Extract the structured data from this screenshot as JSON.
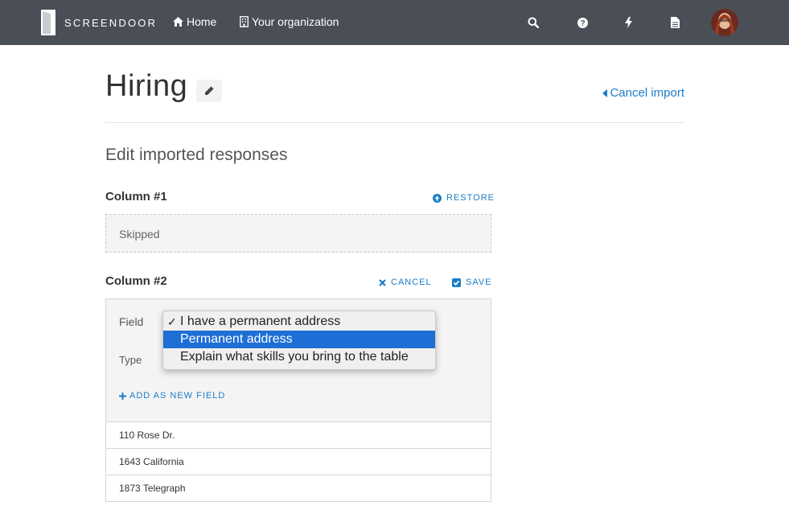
{
  "nav": {
    "brand": "SCREENDOOR",
    "home_label": "Home",
    "org_label": "Your organization",
    "icons": [
      "search-icon",
      "help-icon",
      "bolt-icon",
      "document-icon"
    ]
  },
  "header": {
    "title": "Hiring",
    "cancel_import": "Cancel import"
  },
  "section": {
    "title": "Edit imported responses"
  },
  "column1": {
    "heading": "Column #1",
    "restore": "RESTORE",
    "skipped": "Skipped"
  },
  "column2": {
    "heading": "Column #2",
    "cancel": "CANCEL",
    "save": "SAVE",
    "field_label": "Field",
    "type_label": "Type",
    "add_field": "ADD AS NEW FIELD",
    "rows": [
      "110 Rose Dr.",
      "1643 California",
      "1873 Telegraph"
    ]
  },
  "dropdown": {
    "options": [
      {
        "check": "✓",
        "label": "I have a permanent address"
      },
      {
        "check": "",
        "label": "Permanent address"
      },
      {
        "check": "",
        "label": "Explain what skills you bring to the table"
      }
    ],
    "highlighted_index": 1
  },
  "colors": {
    "nav_bg": "#4a4f57",
    "link": "#1b7dc6",
    "highlight": "#1d6fd6"
  }
}
